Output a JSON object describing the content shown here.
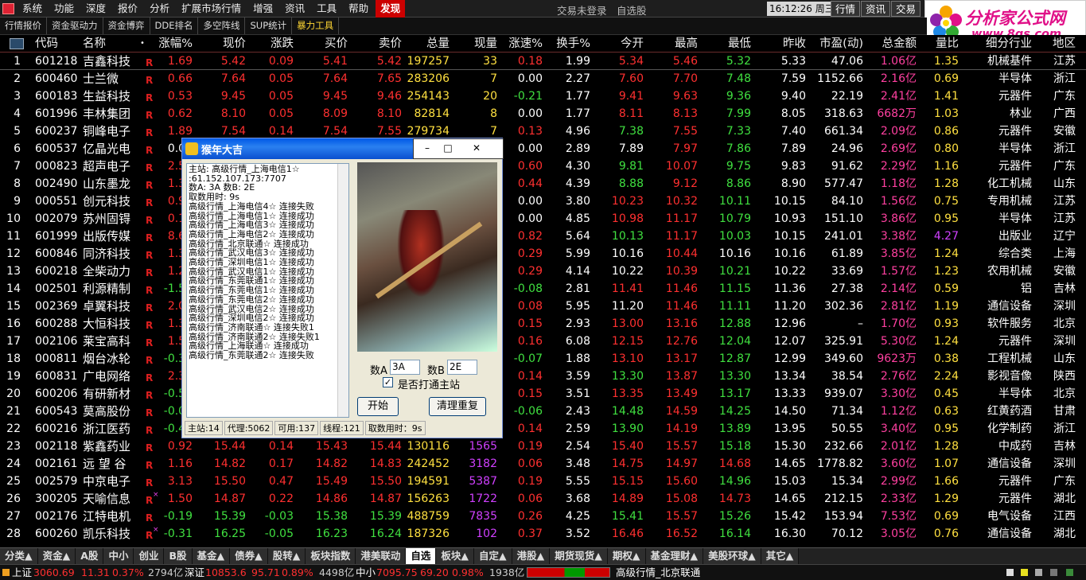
{
  "menubar": {
    "items": [
      "系统",
      "功能",
      "深度",
      "报价",
      "分析",
      "扩展市场行情",
      "增强",
      "资讯",
      "工具",
      "帮助",
      "发现"
    ],
    "active_index": 10,
    "status_text": "交易未登录　自选股",
    "clock": "16:12:26 周三",
    "right_buttons": [
      "行情",
      "资讯",
      "交易"
    ]
  },
  "brand": {
    "title": "分析家公式网",
    "url": "www.8gs.com"
  },
  "toolbar2": {
    "items": [
      "行情报价",
      "资金驱动力",
      "资金博弈",
      "DDE排名",
      "多空阵线",
      "SUP统计",
      "暴力工具"
    ]
  },
  "table": {
    "headers": [
      "代码",
      "名称",
      "涨幅%",
      "现价",
      "涨跌",
      "买价",
      "卖价",
      "总量",
      "现量",
      "涨速%",
      "换手%",
      "今开",
      "最高",
      "最低",
      "昨收",
      "市盈(动)",
      "总金额",
      "量比",
      "细分行业",
      "地区"
    ],
    "rows": [
      [
        "1",
        "601218",
        "吉鑫科技",
        "1.69",
        "5.42",
        "0.09",
        "5.41",
        "5.42",
        "197257",
        "33",
        "0.18",
        "1.99",
        "5.34",
        "5.46",
        "5.32",
        "5.33",
        "47.06",
        "1.06亿",
        "1.35",
        "机械基件",
        "江苏"
      ],
      [
        "2",
        "600460",
        "士兰微",
        "0.66",
        "7.64",
        "0.05",
        "7.64",
        "7.65",
        "283206",
        "7",
        "0.00",
        "2.27",
        "7.60",
        "7.70",
        "7.48",
        "7.59",
        "1152.66",
        "2.16亿",
        "0.69",
        "半导体",
        "浙江"
      ],
      [
        "3",
        "600183",
        "生益科技",
        "0.53",
        "9.45",
        "0.05",
        "9.45",
        "9.46",
        "254143",
        "20",
        "-0.21",
        "1.77",
        "9.41",
        "9.63",
        "9.36",
        "9.40",
        "22.19",
        "2.41亿",
        "1.41",
        "元器件",
        "广东"
      ],
      [
        "4",
        "601996",
        "丰林集团",
        "0.62",
        "8.10",
        "0.05",
        "8.09",
        "8.10",
        "82814",
        "8",
        "0.00",
        "1.77",
        "8.11",
        "8.13",
        "7.99",
        "8.05",
        "318.63",
        "6682万",
        "1.03",
        "林业",
        "广西"
      ],
      [
        "5",
        "600237",
        "铜峰电子",
        "1.89",
        "7.54",
        "0.14",
        "7.54",
        "7.55",
        "279734",
        "7",
        "0.13",
        "4.96",
        "7.38",
        "7.55",
        "7.33",
        "7.40",
        "661.34",
        "2.09亿",
        "0.86",
        "元器件",
        "安徽"
      ],
      [
        "6",
        "600537",
        "亿晶光电",
        "0.00",
        "7.89",
        "0.00",
        "7.89",
        "7.90",
        "",
        "",
        "0.00",
        "2.89",
        "7.89",
        "7.97",
        "7.86",
        "7.89",
        "24.96",
        "2.69亿",
        "0.80",
        "半导体",
        "浙江"
      ],
      [
        "7",
        "000823",
        "超声电子",
        "2.54",
        "",
        "",
        "",
        "",
        "",
        "",
        "0.60",
        "4.30",
        "9.81",
        "10.07",
        "9.75",
        "9.83",
        "91.62",
        "2.29亿",
        "1.16",
        "元器件",
        "广东"
      ],
      [
        "8",
        "002490",
        "山东墨龙",
        "1.35",
        "",
        "",
        "",
        "",
        "",
        "",
        "0.44",
        "4.39",
        "8.88",
        "9.12",
        "8.86",
        "8.90",
        "577.47",
        "1.18亿",
        "1.28",
        "化工机械",
        "山东"
      ],
      [
        "9",
        "000551",
        "创元科技",
        "0.98",
        "",
        "",
        "",
        "",
        "",
        "",
        "0.00",
        "3.80",
        "10.23",
        "10.32",
        "10.11",
        "10.15",
        "84.10",
        "1.56亿",
        "0.75",
        "专用机械",
        "江苏"
      ],
      [
        "10",
        "002079",
        "苏州固锝",
        "0.18",
        "",
        "",
        "",
        "",
        "",
        "",
        "0.00",
        "4.85",
        "10.98",
        "11.17",
        "10.79",
        "10.93",
        "151.10",
        "3.86亿",
        "0.95",
        "半导体",
        "江苏"
      ],
      [
        "11",
        "601999",
        "出版传媒",
        "8.65",
        "",
        "",
        "",
        "",
        "",
        "",
        "0.82",
        "5.64",
        "10.13",
        "11.17",
        "10.03",
        "10.15",
        "241.01",
        "3.38亿",
        "4.27",
        "出版业",
        "辽宁"
      ],
      [
        "12",
        "600846",
        "同济科技",
        "1.38",
        "",
        "",
        "",
        "",
        "",
        "",
        "0.29",
        "5.99",
        "10.16",
        "10.44",
        "10.16",
        "10.16",
        "61.89",
        "3.85亿",
        "1.24",
        "综合类",
        "上海"
      ],
      [
        "13",
        "600218",
        "全柴动力",
        "1.27",
        "",
        "",
        "",
        "",
        "",
        "",
        "0.29",
        "4.14",
        "10.22",
        "10.39",
        "10.21",
        "10.22",
        "33.69",
        "1.57亿",
        "1.23",
        "农用机械",
        "安徽"
      ],
      [
        "14",
        "002501",
        "利源精制",
        "-1.58",
        "",
        "",
        "",
        "",
        "",
        "",
        "-0.08",
        "2.81",
        "11.41",
        "11.46",
        "11.15",
        "11.36",
        "27.38",
        "2.14亿",
        "0.59",
        "铝",
        "吉林"
      ],
      [
        "15",
        "002369",
        "卓翼科技",
        "2.05",
        "",
        "",
        "",
        "",
        "",
        "",
        "0.08",
        "5.95",
        "11.20",
        "11.46",
        "11.11",
        "11.20",
        "302.36",
        "2.81亿",
        "1.19",
        "通信设备",
        "深圳"
      ],
      [
        "16",
        "600288",
        "大恒科技",
        "1.39",
        "",
        "",
        "",
        "",
        "",
        "",
        "0.15",
        "2.93",
        "13.00",
        "13.16",
        "12.88",
        "12.96",
        "–",
        "1.70亿",
        "0.93",
        "软件服务",
        "北京"
      ],
      [
        "17",
        "002106",
        "莱宝高科",
        "1.56",
        "",
        "",
        "",
        "",
        "",
        "",
        "0.16",
        "6.08",
        "12.15",
        "12.76",
        "12.04",
        "12.07",
        "325.91",
        "5.30亿",
        "1.24",
        "元器件",
        "深圳"
      ],
      [
        "18",
        "000811",
        "烟台冰轮",
        "-0.31",
        "",
        "",
        "",
        "",
        "",
        "",
        "-0.07",
        "1.88",
        "13.10",
        "13.17",
        "12.87",
        "12.99",
        "349.60",
        "9623万",
        "0.38",
        "工程机械",
        "山东"
      ],
      [
        "19",
        "600831",
        "广电网络",
        "2.32",
        "",
        "",
        "",
        "",
        "",
        "",
        "0.14",
        "3.59",
        "13.30",
        "13.87",
        "13.30",
        "13.34",
        "38.54",
        "2.76亿",
        "2.24",
        "影视音像",
        "陕西"
      ],
      [
        "20",
        "600206",
        "有研新材",
        "-0.53",
        "",
        "",
        "",
        "",
        "",
        "",
        "0.15",
        "3.51",
        "13.35",
        "13.49",
        "13.17",
        "13.33",
        "939.07",
        "3.30亿",
        "0.45",
        "半导体",
        "北京"
      ],
      [
        "21",
        "600543",
        "莫高股份",
        "-0.07",
        "",
        "",
        "",
        "",
        "",
        "",
        "-0.06",
        "2.43",
        "14.48",
        "14.59",
        "14.25",
        "14.50",
        "71.34",
        "1.12亿",
        "0.63",
        "红黄药酒",
        "甘肃"
      ],
      [
        "22",
        "600216",
        "浙江医药",
        "-0.41",
        "",
        "",
        "",
        "",
        "",
        "",
        "0.14",
        "2.59",
        "13.90",
        "14.19",
        "13.89",
        "13.95",
        "50.55",
        "3.40亿",
        "0.95",
        "化学制药",
        "浙江"
      ],
      [
        "23",
        "002118",
        "紫鑫药业",
        "0.92",
        "15.44",
        "0.14",
        "15.43",
        "15.44",
        "130116",
        "1565",
        "0.19",
        "2.54",
        "15.40",
        "15.57",
        "15.18",
        "15.30",
        "232.66",
        "2.01亿",
        "1.28",
        "中成药",
        "吉林"
      ],
      [
        "24",
        "002161",
        "远 望 谷",
        "1.16",
        "14.82",
        "0.17",
        "14.82",
        "14.83",
        "242452",
        "3182",
        "0.06",
        "3.48",
        "14.75",
        "14.97",
        "14.68",
        "14.65",
        "1778.82",
        "3.60亿",
        "1.07",
        "通信设备",
        "深圳"
      ],
      [
        "25",
        "002579",
        "中京电子",
        "3.13",
        "15.50",
        "0.47",
        "15.49",
        "15.50",
        "194591",
        "5387",
        "0.19",
        "5.55",
        "15.15",
        "15.60",
        "14.96",
        "15.03",
        "15.34",
        "2.99亿",
        "1.66",
        "元器件",
        "广东"
      ],
      [
        "26",
        "300205",
        "天喻信息",
        "1.50",
        "14.87",
        "0.22",
        "14.86",
        "14.87",
        "156263",
        "1722",
        "0.06",
        "3.68",
        "14.89",
        "15.08",
        "14.73",
        "14.65",
        "212.15",
        "2.33亿",
        "1.29",
        "元器件",
        "湖北"
      ],
      [
        "27",
        "002176",
        "江特电机",
        "-0.19",
        "15.39",
        "-0.03",
        "15.38",
        "15.39",
        "488759",
        "7835",
        "0.26",
        "4.25",
        "15.41",
        "15.57",
        "15.26",
        "15.42",
        "153.94",
        "7.53亿",
        "0.69",
        "电气设备",
        "江西"
      ],
      [
        "28",
        "600260",
        "凯乐科技",
        "-0.31",
        "16.25",
        "-0.05",
        "16.23",
        "16.24",
        "187326",
        "102",
        "0.37",
        "3.52",
        "16.46",
        "16.52",
        "16.14",
        "16.30",
        "70.12",
        "3.05亿",
        "0.76",
        "通信设备",
        "湖北"
      ]
    ],
    "x_mark_rows": [
      26,
      28
    ]
  },
  "tabs": {
    "items": [
      "分类▲",
      "资金▲",
      "A股",
      "中小",
      "创业",
      "B股",
      "基金▲",
      "债券▲",
      "股转▲",
      "板块指数",
      "港美联动",
      "自选",
      "板块▲",
      "自定▲",
      "港股▲",
      "期货现货▲",
      "期权▲",
      "基金理财▲",
      "美股环球▲",
      "其它▲"
    ],
    "active_index": 11
  },
  "status": {
    "sh_label": "上证",
    "sh_value": "3060.69",
    "sh_change": "11.31",
    "sh_pct": "0.37%",
    "sh_amount": "2794亿",
    "sz_label": "深证",
    "sz_value": "10853.6",
    "sz_change": "95.71",
    "sz_pct": "0.89%",
    "sz_amount": "4498亿",
    "zx_label": "中小",
    "zx_value": "7095.75",
    "zx_change": "69.20",
    "zx_pct": "0.98%",
    "zx_amount": "1938亿",
    "server": "高级行情_北京联通"
  },
  "dialog": {
    "title": "猴年大吉",
    "log_lines": [
      "主站: 高级行情_上海电信1☆",
      ":61.152.107.173:7707",
      "数A: 3A  数B: 2E",
      "取数用时: 9s",
      "高级行情_上海电信4☆  连接失败",
      "高级行情_上海电信1☆  连接成功",
      "高级行情_上海电信3☆  连接成功",
      "高级行情_上海电信2☆  连接成功",
      "高级行情_北京联通☆  连接成功",
      "高级行情_武汉电信3☆  连接成功",
      "高级行情_深圳电信1☆  连接成功",
      "高级行情_武汉电信1☆  连接成功",
      "高级行情_东莞联通1☆  连接成功",
      "高级行情_东莞电信1☆  连接成功",
      "高级行情_东莞电信2☆  连接成功",
      "高级行情_武汉电信2☆  连接成功",
      "高级行情_深圳电信2☆  连接成功",
      "高级行情_济南联通☆  连接失败1",
      "高级行情_济南联通2☆  连接失败1",
      "高级行情_上海联通☆  连接成功",
      "高级行情_东莞联通2☆  连接失败"
    ],
    "field_a_label": "数A",
    "field_a_value": "3A",
    "field_b_label": "数B",
    "field_b_value": "2E",
    "checkbox_label": "是否打通主站",
    "checkbox_checked": true,
    "start_button": "开始",
    "reset_button": "清理重复",
    "statusbar": [
      "主站:14",
      "代理:5062",
      "可用:137",
      "线程:121",
      "取数用时：9s"
    ]
  }
}
